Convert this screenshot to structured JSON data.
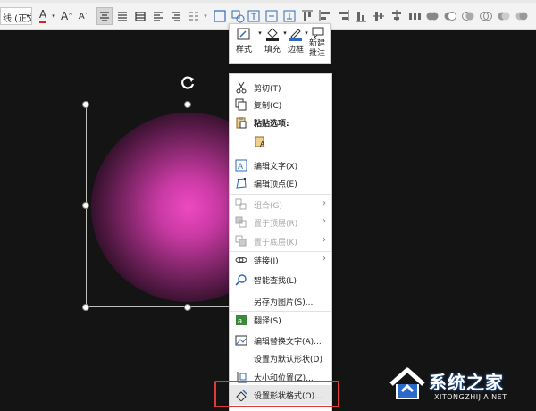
{
  "ribbon": {
    "font_name": "线 (正文",
    "font_color_label": "A",
    "grow_label": "A",
    "shrink_label": "A"
  },
  "mini_toolbar": {
    "style_label": "样式",
    "fill_label": "填充",
    "outline_label": "边框",
    "new_comment_label": "新建批注"
  },
  "context_menu": {
    "cut": "剪切(T)",
    "copy": "复制(C)",
    "paste_options": "粘贴选项:",
    "edit_text": "编辑文字(X)",
    "edit_points": "编辑顶点(E)",
    "group": "组合(G)",
    "bring_to_front": "置于顶层(R)",
    "send_to_back": "置于底层(K)",
    "link": "链接(I)",
    "smart_lookup": "智能查找(L)",
    "save_as_picture": "另存为图片(S)...",
    "translate": "翻译(S)",
    "edit_alt_text": "编辑替换文字(A)...",
    "set_default_shape": "设置为默认形状(D)",
    "size_position": "大小和位置(Z)...",
    "format_shape": "设置形状格式(O)..."
  },
  "watermark": {
    "brand": "系统之家",
    "url": "XITONGZHIJIA.NET"
  },
  "colors": {
    "canvas_bg": "#141414",
    "font_color_bar": "#e02020",
    "highlight_border": "#e03a3a",
    "sphere_center": "#ee49c0"
  }
}
